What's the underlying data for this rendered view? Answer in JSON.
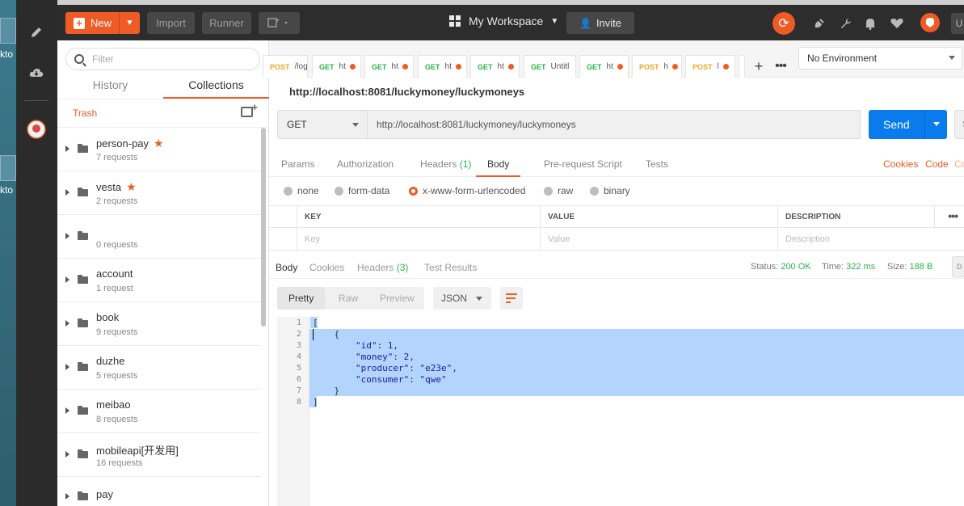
{
  "desktop": {
    "labels": [
      "kto",
      "kto"
    ]
  },
  "toolbar": {
    "new_label": "New",
    "import_label": "Import",
    "runner_label": "Runner",
    "workspace_label": "My Workspace",
    "invite_label": "Invite",
    "avatar_letter": "U"
  },
  "sidebar": {
    "filter_placeholder": "Filter",
    "tabs": [
      "History",
      "Collections"
    ],
    "active_tab": "Collections",
    "trash_label": "Trash",
    "collections": [
      {
        "name": "person-pay",
        "count": "7 requests",
        "starred": true
      },
      {
        "name": "vesta",
        "count": "2 requests",
        "starred": true
      },
      {
        "name": "",
        "count": "0 requests",
        "starred": false
      },
      {
        "name": "account",
        "count": "1 request",
        "starred": false
      },
      {
        "name": "book",
        "count": "9 requests",
        "starred": false
      },
      {
        "name": "duzhe",
        "count": "5 requests",
        "starred": false
      },
      {
        "name": "meibao",
        "count": "8 requests",
        "starred": false
      },
      {
        "name": "mobileapi[开发用]",
        "count": "16 requests",
        "starred": false
      },
      {
        "name": "pay",
        "count": "",
        "starred": false
      }
    ]
  },
  "request_tabs": [
    {
      "method": "POST",
      "title": "/logi",
      "unsaved": false
    },
    {
      "method": "GET",
      "title": "ht",
      "unsaved": true
    },
    {
      "method": "GET",
      "title": "ht",
      "unsaved": true
    },
    {
      "method": "GET",
      "title": "ht",
      "unsaved": true
    },
    {
      "method": "GET",
      "title": "ht",
      "unsaved": true
    },
    {
      "method": "GET",
      "title": "Untitl",
      "unsaved": false
    },
    {
      "method": "GET",
      "title": "ht",
      "unsaved": true
    },
    {
      "method": "POST",
      "title": "h",
      "unsaved": true
    },
    {
      "method": "POST",
      "title": "l",
      "unsaved": true
    }
  ],
  "environment": "No Environment",
  "request": {
    "title": "http://localhost:8081/luckymoney/luckymoneys",
    "method": "GET",
    "url": "http://localhost:8081/luckymoney/luckymoneys",
    "send_label": "Send",
    "save_peek": "S"
  },
  "request_tabs_sub": {
    "params": "Params",
    "authorization": "Authorization",
    "headers": "Headers",
    "headers_count": "(1)",
    "body": "Body",
    "prerequest": "Pre-request Script",
    "tests": "Tests",
    "cookies": "Cookies",
    "code": "Code",
    "peek": "Co"
  },
  "body_options": [
    "none",
    "form-data",
    "x-www-form-urlencoded",
    "raw",
    "binary"
  ],
  "body_selected": "x-www-form-urlencoded",
  "kv_table": {
    "headers": [
      "KEY",
      "VALUE",
      "DESCRIPTION"
    ],
    "placeholders": [
      "Key",
      "Value",
      "Description"
    ]
  },
  "response": {
    "tabs": {
      "body": "Body",
      "cookies": "Cookies",
      "headers": "Headers",
      "headers_count": "(3)",
      "test_results": "Test Results"
    },
    "status_label": "Status:",
    "status_value": "200 OK",
    "time_label": "Time:",
    "time_value": "322 ms",
    "size_label": "Size:",
    "size_value": "188 B",
    "peek": "D",
    "view_modes": [
      "Pretty",
      "Raw",
      "Preview"
    ],
    "format": "JSON",
    "lines": [
      "1",
      "2",
      "3",
      "4",
      "5",
      "6",
      "7",
      "8"
    ],
    "code": {
      "l1": "[",
      "l2": "    {",
      "k_id": "\"id\"",
      "v_id": "1",
      "k_money": "\"money\"",
      "v_money": "2",
      "k_producer": "\"producer\"",
      "v_producer": "\"e23e\"",
      "k_consumer": "\"consumer\"",
      "v_consumer": "\"qwe\"",
      "l7": "    }",
      "l8": "]"
    }
  }
}
